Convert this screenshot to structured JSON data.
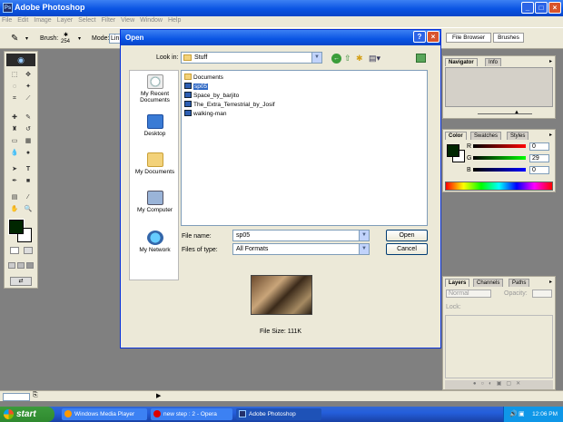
{
  "app": {
    "title": "Adobe Photoshop"
  },
  "menu": [
    "File",
    "Edit",
    "Image",
    "Layer",
    "Select",
    "Filter",
    "View",
    "Window",
    "Help"
  ],
  "options": {
    "brush_label": "Brush:",
    "brush_size": "254",
    "mode_label": "Mode:",
    "mode_value": "Lin"
  },
  "wells": {
    "file_browser": "File Browser",
    "brushes": "Brushes"
  },
  "navigator": {
    "tabs": [
      "Navigator",
      "Info"
    ]
  },
  "color": {
    "tabs": [
      "Color",
      "Swatches",
      "Styles"
    ],
    "r_label": "R",
    "g_label": "G",
    "b_label": "B",
    "r": "0",
    "g": "29",
    "b": "0"
  },
  "layers": {
    "tabs": [
      "Layers",
      "Channels",
      "Paths"
    ],
    "blend": "Normal",
    "opacity_label": "Opacity:",
    "lock_label": "Lock:"
  },
  "dialog": {
    "title": "Open",
    "look_in_label": "Look in:",
    "look_in_value": "Stuff",
    "places": [
      "My Recent Documents",
      "Desktop",
      "My Documents",
      "My Computer",
      "My Network"
    ],
    "files": [
      {
        "name": "Documents",
        "type": "folder"
      },
      {
        "name": "sp05",
        "type": "psd",
        "selected": true
      },
      {
        "name": "Space_by_barjito",
        "type": "psd"
      },
      {
        "name": "The_Extra_Terrestrial_by_Josif",
        "type": "psd"
      },
      {
        "name": "walking-man",
        "type": "psd"
      }
    ],
    "file_name_label": "File name:",
    "file_name_value": "sp05",
    "file_type_label": "Files of type:",
    "file_type_value": "All Formats",
    "open_label": "Open",
    "cancel_label": "Cancel",
    "file_size": "File Size: 111K"
  },
  "statusbar": {
    "zoom": ""
  },
  "taskbar": {
    "start": "start",
    "items": [
      "Windows Media Player",
      "new step : 2 - Opera",
      "Adobe Photoshop"
    ],
    "clock": "12:06 PM"
  },
  "colors": {
    "title_blue": "#0a54e3",
    "taskbar_blue": "#245edb",
    "start_green": "#2f8a2f"
  }
}
